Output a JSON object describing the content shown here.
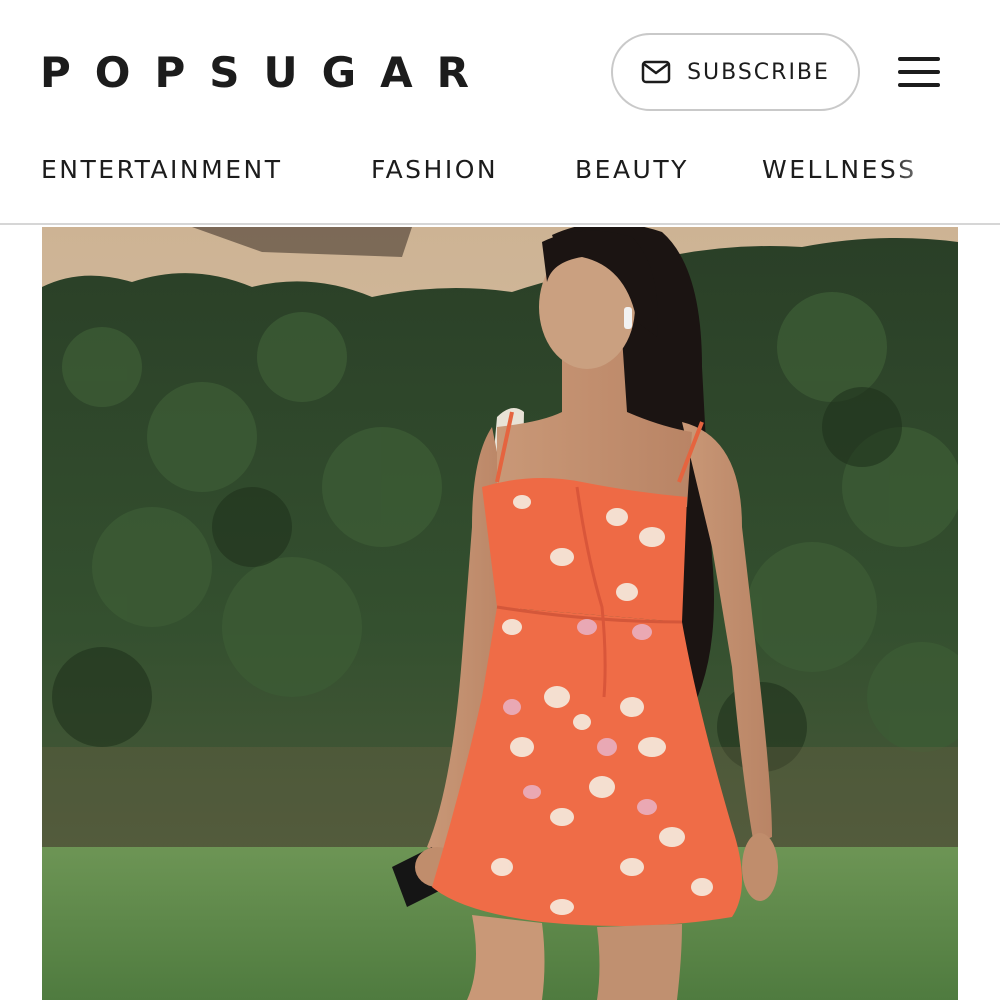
{
  "header": {
    "logo_text": "POPSUGAR",
    "subscribe_label": "SUBSCRIBE",
    "subscribe_icon": "mail-icon",
    "menu_icon": "hamburger-menu-icon"
  },
  "nav": {
    "items": [
      {
        "label": "ENTERTAINMENT"
      },
      {
        "label": "FASHION"
      },
      {
        "label": "BEAUTY"
      },
      {
        "label": "WELLNESS"
      }
    ]
  },
  "hero": {
    "dress_color": "#ee6a45",
    "foliage_color": "#2f4a2b",
    "wall_color": "#d9c2a6",
    "grass_color": "#5d8a4a"
  }
}
